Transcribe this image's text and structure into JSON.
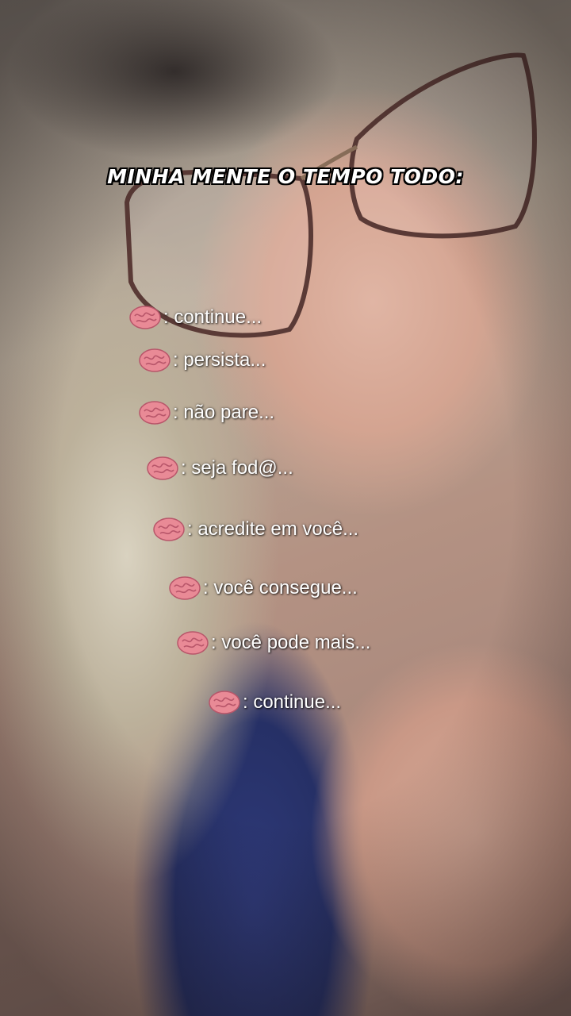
{
  "overlay": {
    "headline": "MINHA MENTE O TEMPO TODO:",
    "lines": [
      {
        "icon": "brain-icon",
        "text": ": continue..."
      },
      {
        "icon": "brain-icon",
        "text": ": persista..."
      },
      {
        "icon": "brain-icon",
        "text": ": não pare..."
      },
      {
        "icon": "brain-icon",
        "text": ": seja fod@..."
      },
      {
        "icon": "brain-icon",
        "text": ": acredite em você..."
      },
      {
        "icon": "brain-icon",
        "text": ": você consegue..."
      },
      {
        "icon": "brain-icon",
        "text": ": você pode mais..."
      },
      {
        "icon": "brain-icon",
        "text": ": continue..."
      }
    ]
  },
  "colors": {
    "text": "#ffffff",
    "brain": "#e98a96"
  }
}
